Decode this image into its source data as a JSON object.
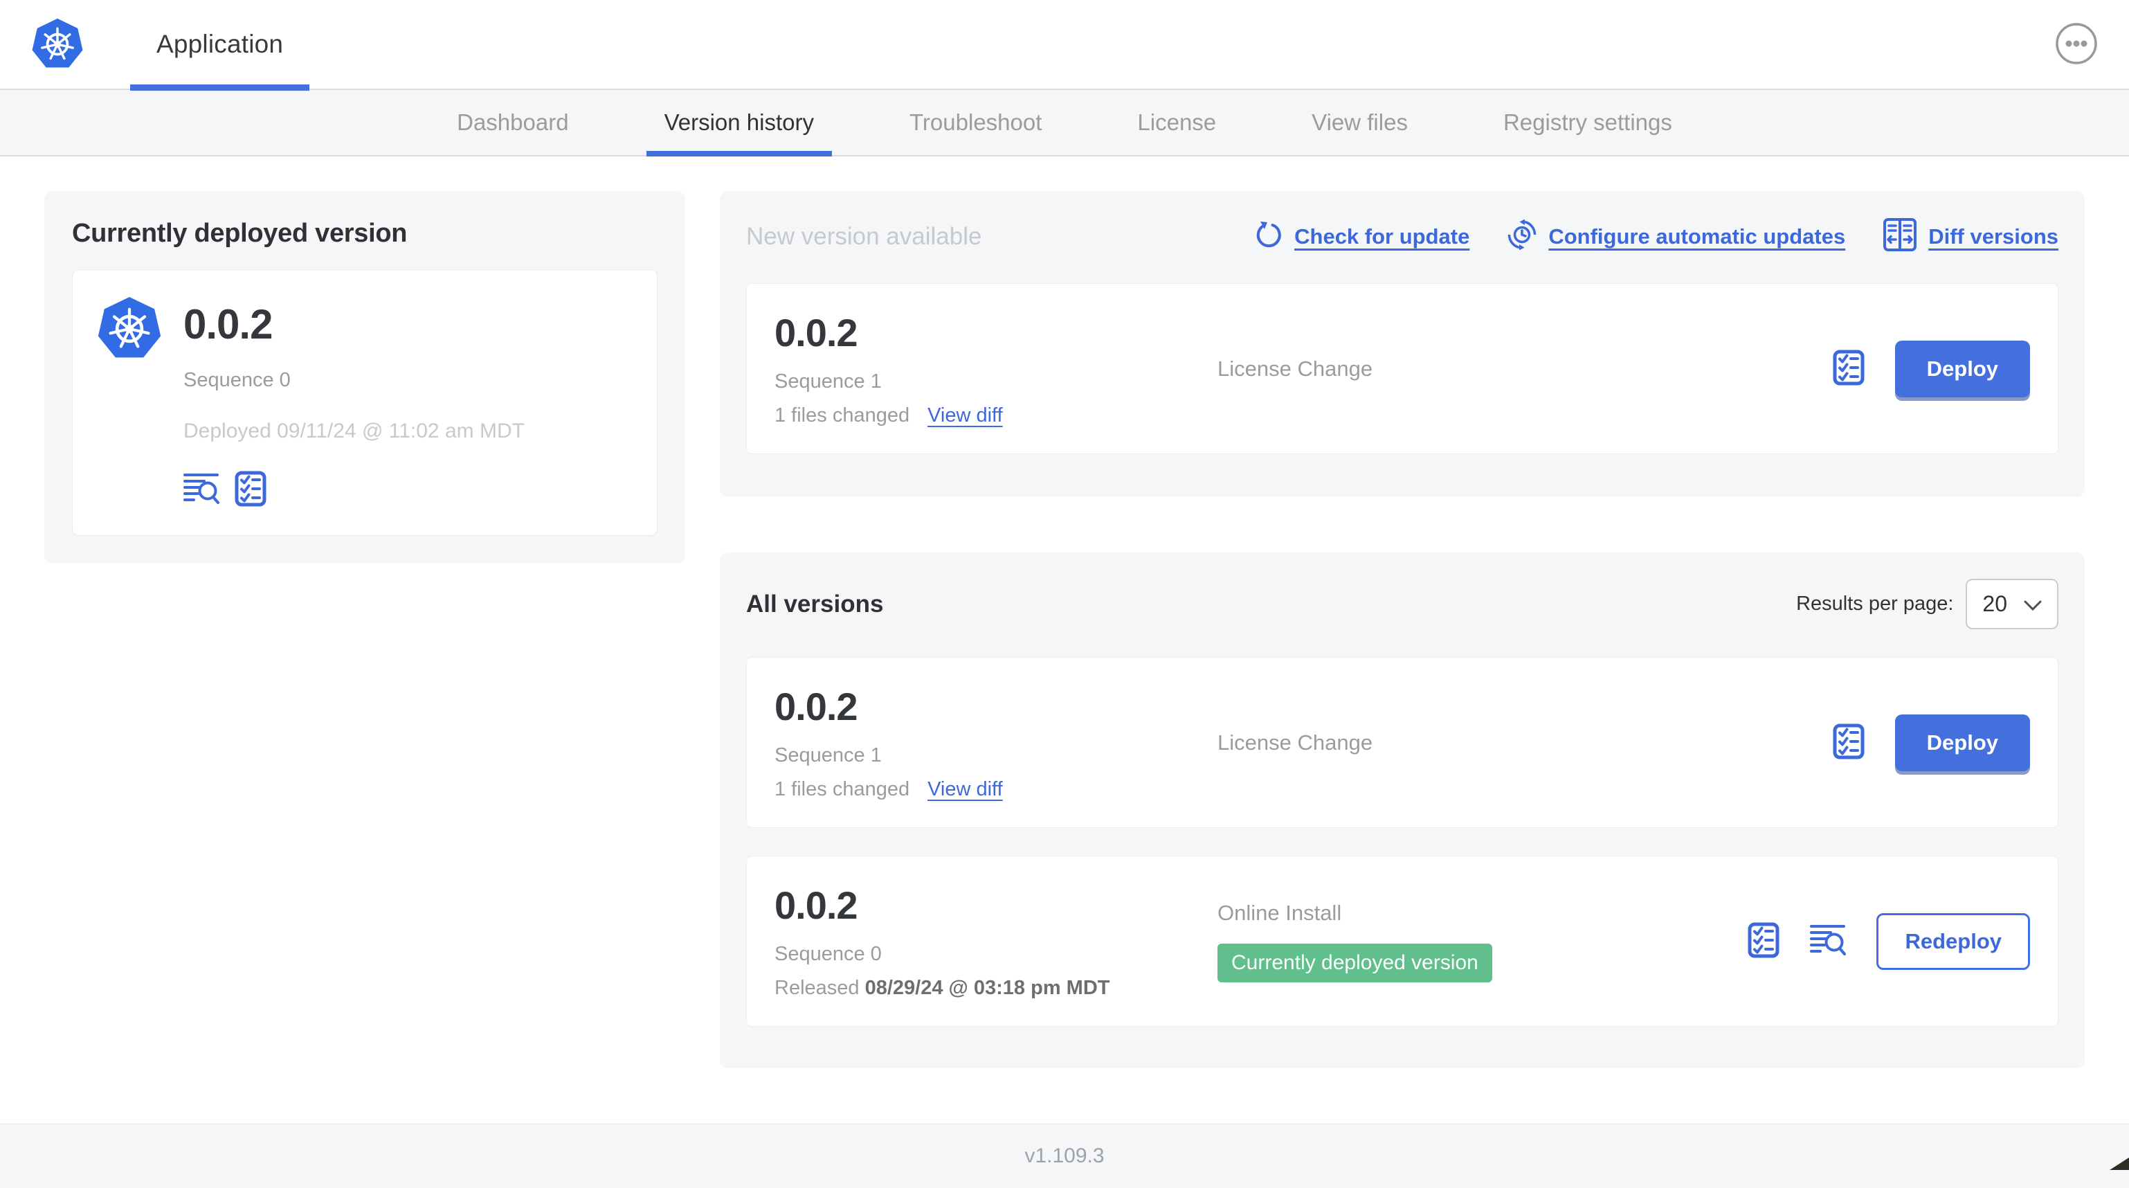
{
  "header": {
    "app_title": "Application"
  },
  "nav": {
    "active_tab": "Version history",
    "tabs": [
      {
        "label": "Dashboard"
      },
      {
        "label": "Version history"
      },
      {
        "label": "Troubleshoot"
      },
      {
        "label": "License"
      },
      {
        "label": "View files"
      },
      {
        "label": "Registry settings"
      }
    ]
  },
  "current_version_card": {
    "title": "Currently deployed version",
    "version": "0.0.2",
    "sequence": "Sequence 0",
    "deployed": "Deployed 09/11/24 @ 11:02 am MDT"
  },
  "new_version_section": {
    "title": "New version available",
    "actions": {
      "check_for_update": "Check for update",
      "configure_automatic_updates": "Configure automatic updates",
      "diff_versions": "Diff versions"
    },
    "row": {
      "version": "0.0.2",
      "sequence": "Sequence 1",
      "files_changed": "1 files changed",
      "view_diff": "View diff",
      "source": "License Change",
      "action": "Deploy"
    }
  },
  "all_versions_section": {
    "title": "All versions",
    "results_per_page_label": "Results per page:",
    "results_per_page_value": "20",
    "rows": [
      {
        "version": "0.0.2",
        "sequence": "Sequence 1",
        "files_changed": "1 files changed",
        "view_diff": "View diff",
        "source": "License Change",
        "action": "Deploy"
      },
      {
        "version": "0.0.2",
        "sequence": "Sequence 0",
        "released_label": "Released",
        "released_date": "08/29/24 @ 03:18 pm MDT",
        "source": "Online Install",
        "badge": "Currently deployed version",
        "action": "Redeploy"
      }
    ]
  },
  "footer": {
    "app_version": "v1.109.3"
  },
  "colors": {
    "accent_blue": "#3D68D9",
    "button_blue": "#4470DE",
    "kubernetes_blue": "#326CE5",
    "badge_green": "#61BF8E",
    "panel_gray": "#F4F6F8"
  }
}
